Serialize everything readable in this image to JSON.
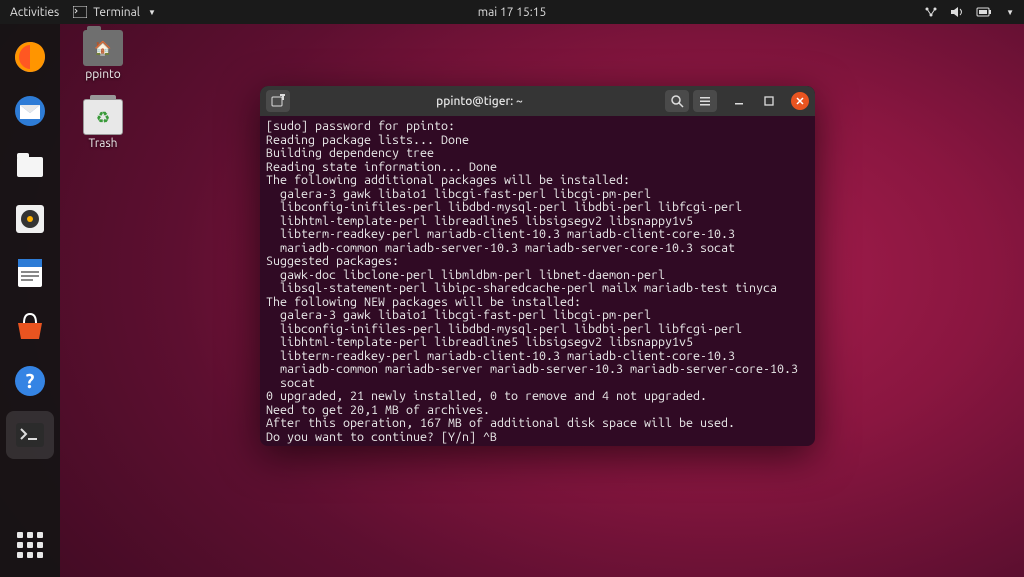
{
  "topbar": {
    "activities": "Activities",
    "app_name": "Terminal",
    "clock": "mai 17  15:15"
  },
  "desktop": {
    "icons": [
      {
        "name": "home-folder",
        "label": "ppinto",
        "glyph": "🏠"
      },
      {
        "name": "trash",
        "label": "Trash",
        "glyph": "♻"
      }
    ]
  },
  "terminal": {
    "title": "ppinto@tiger: ~",
    "lines": [
      "[sudo] password for ppinto:",
      "Reading package lists... Done",
      "Building dependency tree",
      "Reading state information... Done",
      "The following additional packages will be installed:",
      "  galera-3 gawk libaio1 libcgi-fast-perl libcgi-pm-perl",
      "  libconfig-inifiles-perl libdbd-mysql-perl libdbi-perl libfcgi-perl",
      "  libhtml-template-perl libreadline5 libsigsegv2 libsnappy1v5",
      "  libterm-readkey-perl mariadb-client-10.3 mariadb-client-core-10.3",
      "  mariadb-common mariadb-server-10.3 mariadb-server-core-10.3 socat",
      "Suggested packages:",
      "  gawk-doc libclone-perl libmldbm-perl libnet-daemon-perl",
      "  libsql-statement-perl libipc-sharedcache-perl mailx mariadb-test tinyca",
      "The following NEW packages will be installed:",
      "  galera-3 gawk libaio1 libcgi-fast-perl libcgi-pm-perl",
      "  libconfig-inifiles-perl libdbd-mysql-perl libdbi-perl libfcgi-perl",
      "  libhtml-template-perl libreadline5 libsigsegv2 libsnappy1v5",
      "  libterm-readkey-perl mariadb-client-10.3 mariadb-client-core-10.3",
      "  mariadb-common mariadb-server mariadb-server-10.3 mariadb-server-core-10.3",
      "  socat",
      "0 upgraded, 21 newly installed, 0 to remove and 4 not upgraded.",
      "Need to get 20,1 MB of archives.",
      "After this operation, 167 MB of additional disk space will be used.",
      "Do you want to continue? [Y/n] ^B"
    ]
  }
}
